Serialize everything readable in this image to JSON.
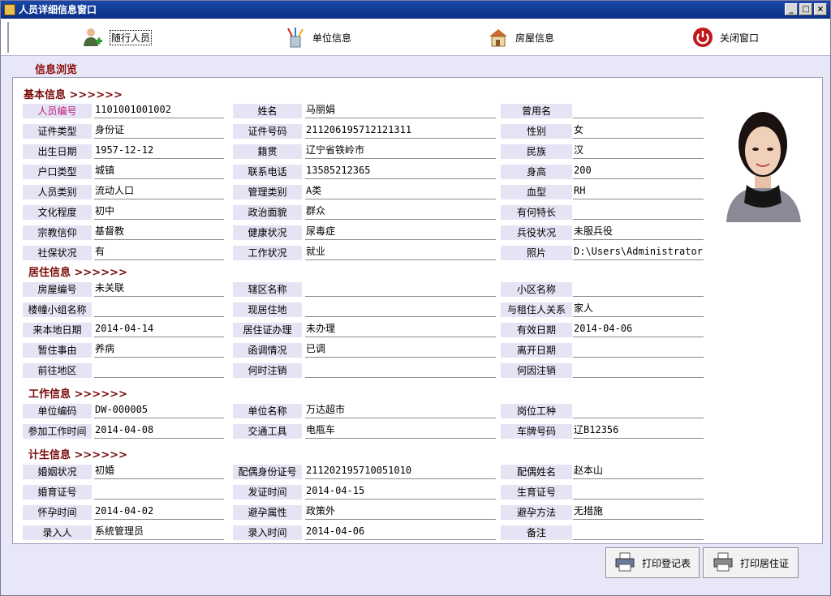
{
  "window": {
    "title": "人员详细信息窗口",
    "controls": [
      "_",
      "□",
      "×"
    ]
  },
  "toolbar": {
    "items": [
      {
        "label": "随行人员",
        "icon": "person-add-icon"
      },
      {
        "label": "单位信息",
        "icon": "pencil-cup-icon"
      },
      {
        "label": "房屋信息",
        "icon": "house-icon"
      },
      {
        "label": "关闭窗口",
        "icon": "power-icon"
      }
    ]
  },
  "panel_title": "信息浏览",
  "sections": {
    "basic": "基本信息 >>>>>>",
    "residence": "居住信息 >>>>>>",
    "work": "工作信息 >>>>>>",
    "family": "计生信息 >>>>>>"
  },
  "fields": {
    "person_no": {
      "label": "人员编号",
      "value": "1101001001002"
    },
    "name": {
      "label": "姓名",
      "value": "马丽娟"
    },
    "former_name": {
      "label": "曾用名",
      "value": ""
    },
    "id_type": {
      "label": "证件类型",
      "value": "身份证"
    },
    "id_no": {
      "label": "证件号码",
      "value": "211206195712121311"
    },
    "gender": {
      "label": "性别",
      "value": "女"
    },
    "birth_date": {
      "label": "出生日期",
      "value": "1957-12-12"
    },
    "native_place": {
      "label": "籍贯",
      "value": "辽宁省铁岭市"
    },
    "ethnicity": {
      "label": "民族",
      "value": "汉"
    },
    "hukou_type": {
      "label": "户口类型",
      "value": "城镇"
    },
    "phone": {
      "label": "联系电话",
      "value": "13585212365"
    },
    "height": {
      "label": "身高",
      "value": "200"
    },
    "person_cat": {
      "label": "人员类别",
      "value": "流动人口"
    },
    "mgmt_cat": {
      "label": "管理类别",
      "value": "A类"
    },
    "blood": {
      "label": "血型",
      "value": "RH"
    },
    "education": {
      "label": "文化程度",
      "value": "初中"
    },
    "politics": {
      "label": "政治面貌",
      "value": "群众"
    },
    "specialty": {
      "label": "有何特长",
      "value": ""
    },
    "religion": {
      "label": "宗教信仰",
      "value": "基督教"
    },
    "health": {
      "label": "健康状况",
      "value": "尿毒症"
    },
    "military": {
      "label": "兵役状况",
      "value": "未服兵役"
    },
    "insurance": {
      "label": "社保状况",
      "value": "有"
    },
    "work_status": {
      "label": "工作状况",
      "value": "就业"
    },
    "photo": {
      "label": "照片",
      "value": "D:\\Users\\Administrator\\"
    },
    "house_no": {
      "label": "房屋编号",
      "value": "未关联"
    },
    "district": {
      "label": "辖区名称",
      "value": ""
    },
    "community": {
      "label": "小区名称",
      "value": ""
    },
    "building_group": {
      "label": "楼幢小组名称",
      "value": ""
    },
    "current_addr": {
      "label": "现居住地",
      "value": ""
    },
    "landlord_rel": {
      "label": "与租住人关系",
      "value": "家人"
    },
    "arrival_date": {
      "label": "来本地日期",
      "value": "2014-04-14"
    },
    "permit": {
      "label": "居住证办理",
      "value": "未办理"
    },
    "valid_date": {
      "label": "有效日期",
      "value": "2014-04-06"
    },
    "stay_reason": {
      "label": "暂住事由",
      "value": "养病"
    },
    "letter": {
      "label": "函调情况",
      "value": "已调"
    },
    "leave_date": {
      "label": "离开日期",
      "value": ""
    },
    "dest": {
      "label": "前往地区",
      "value": ""
    },
    "cancel_time": {
      "label": "何时注销",
      "value": ""
    },
    "cancel_reason": {
      "label": "何因注销",
      "value": ""
    },
    "unit_code": {
      "label": "单位编码",
      "value": "DW-000005"
    },
    "unit_name": {
      "label": "单位名称",
      "value": "万达超市"
    },
    "position": {
      "label": "岗位工种",
      "value": ""
    },
    "work_start": {
      "label": "参加工作时间",
      "value": "2014-04-08"
    },
    "vehicle": {
      "label": "交通工具",
      "value": "电瓶车"
    },
    "plate": {
      "label": "车牌号码",
      "value": "辽B12356"
    },
    "marital": {
      "label": "婚姻状况",
      "value": "初婚"
    },
    "spouse_id": {
      "label": "配偶身份证号",
      "value": "211202195710051010"
    },
    "spouse_name": {
      "label": "配偶姓名",
      "value": "赵本山"
    },
    "marriage_cert": {
      "label": "婚育证号",
      "value": ""
    },
    "cert_time": {
      "label": "发证时间",
      "value": "2014-04-15"
    },
    "birth_cert": {
      "label": "生育证号",
      "value": ""
    },
    "pregnancy_time": {
      "label": "怀孕时间",
      "value": "2014-04-02"
    },
    "contraception_attr": {
      "label": "避孕属性",
      "value": "政策外"
    },
    "contraception_method": {
      "label": "避孕方法",
      "value": "无措施"
    },
    "entered_by": {
      "label": "录入人",
      "value": "系统管理员"
    },
    "entry_time": {
      "label": "录入时间",
      "value": "2014-04-06"
    },
    "remark": {
      "label": "备注",
      "value": ""
    }
  },
  "buttons": {
    "print_record": "打印登记表",
    "print_permit": "打印居住证"
  }
}
